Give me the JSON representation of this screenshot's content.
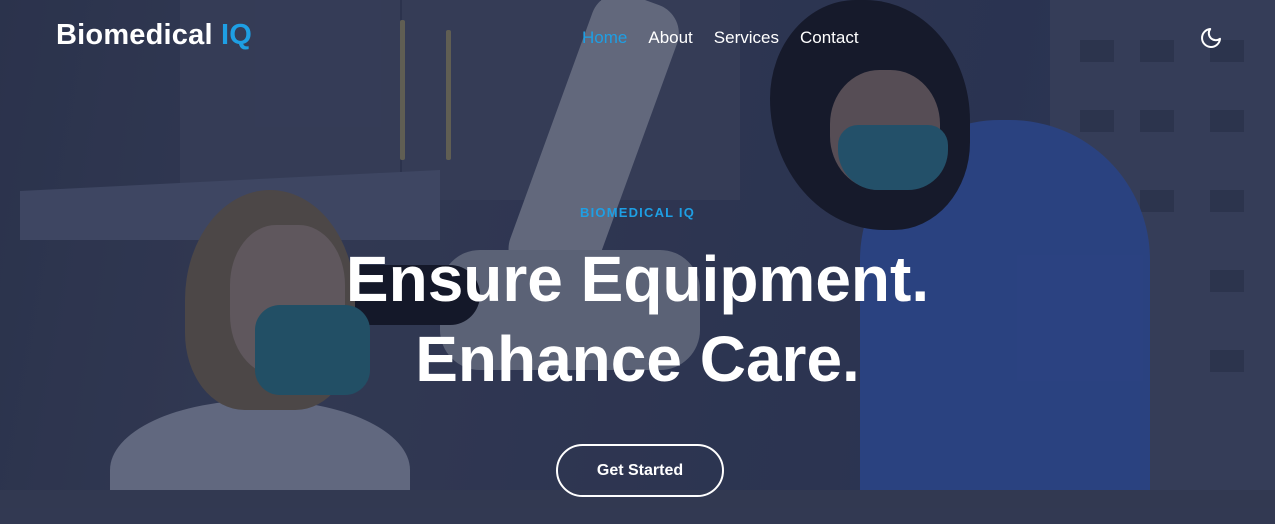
{
  "brand": {
    "name": "Biomedical",
    "accent": "IQ",
    "accent_color": "#1e9fe4"
  },
  "nav": {
    "items": [
      {
        "label": "Home",
        "active": true
      },
      {
        "label": "About",
        "active": false
      },
      {
        "label": "Services",
        "active": false
      },
      {
        "label": "Contact",
        "active": false
      }
    ]
  },
  "theme_toggle": {
    "icon": "moon-icon"
  },
  "hero": {
    "eyebrow": "BIOMEDICAL IQ",
    "headline_line1": "Ensure Equipment.",
    "headline_line2": "Enhance Care.",
    "cta_label": "Get Started",
    "background": "photo of two clinicians in masks using a microscope"
  }
}
